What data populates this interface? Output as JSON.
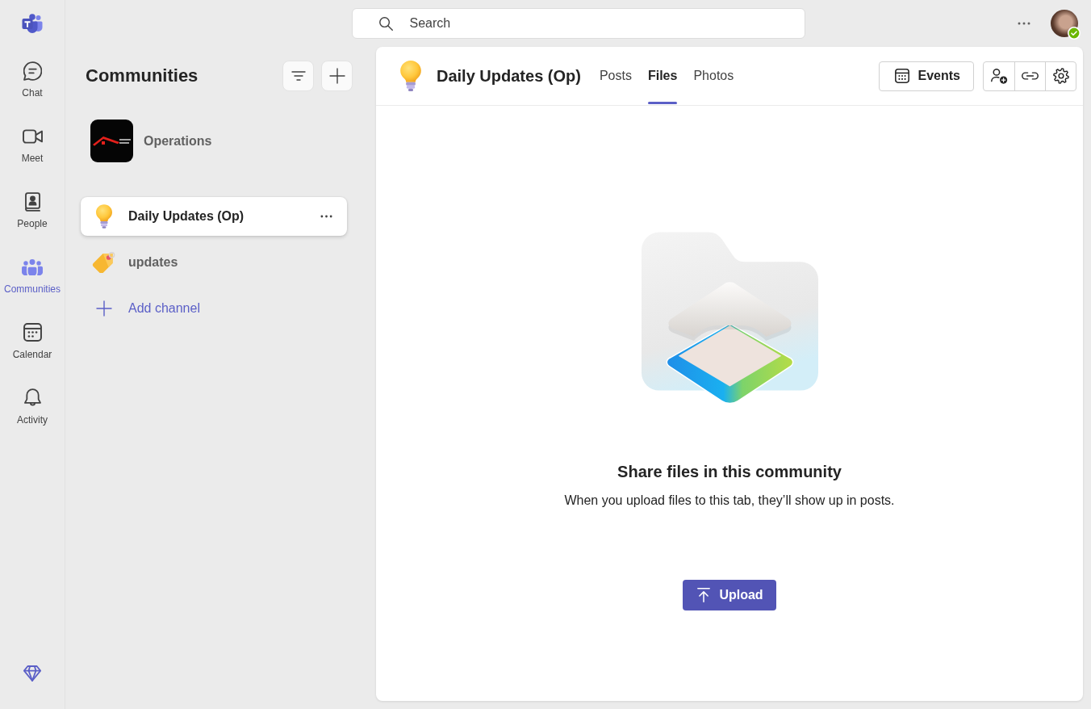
{
  "app_rail": {
    "items": [
      {
        "label": "Chat",
        "selected": false
      },
      {
        "label": "Meet",
        "selected": false
      },
      {
        "label": "People",
        "selected": false
      },
      {
        "label": "Communities",
        "selected": true
      },
      {
        "label": "Calendar",
        "selected": false
      },
      {
        "label": "Activity",
        "selected": false
      }
    ]
  },
  "top_bar": {
    "search": {
      "placeholder": "Search"
    },
    "profile": {
      "available": true
    }
  },
  "communities_pane": {
    "title": "Communities",
    "community": {
      "name": "Operations"
    },
    "channels": [
      {
        "name": "Daily Updates (Op)",
        "selected": true
      },
      {
        "name": "updates",
        "selected": false
      }
    ],
    "add_channel": "Add channel"
  },
  "channel_header": {
    "title": "Daily Updates (Op)",
    "tabs": [
      {
        "label": "Posts",
        "selected": false
      },
      {
        "label": "Files",
        "selected": true
      },
      {
        "label": "Photos",
        "selected": false
      }
    ],
    "events_button": "Events"
  },
  "empty_state": {
    "heading": "Share files in this community",
    "text": "When you upload files to this tab, they’ll show up in posts.",
    "upload_button": "Upload"
  }
}
